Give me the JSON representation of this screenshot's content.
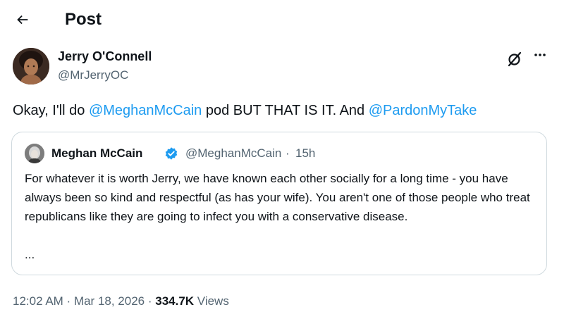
{
  "header": {
    "title": "Post"
  },
  "tweet": {
    "author_name": "Jerry O'Connell",
    "author_handle": "@MrJerryOC",
    "text_part1": "Okay, I'll do ",
    "mention1": "@MeghanMcCain",
    "text_part2": " pod BUT THAT IS IT.  And ",
    "mention2": "@PardonMyTake"
  },
  "quote": {
    "author_name": "Meghan McCain",
    "author_handle": "@MeghanMcCain",
    "separator": "·",
    "time": "15h",
    "text": "For whatever it is worth Jerry, we have known each other socially for a long time - you have always been so kind and respectful (as has your wife). You aren't one of those people who treat republicans like they are going to infect you with a conservative disease.",
    "ellipsis": "..."
  },
  "meta": {
    "time": "12:02 AM",
    "sep1": " · ",
    "date": "Mar 18, 2026",
    "sep2": " · ",
    "views_count": "334.7K",
    "views_label": " Views"
  },
  "icons": {
    "back": "arrow-left-icon",
    "grok": "grok-icon",
    "more": "more-horizontal-icon",
    "verified": "verified-badge-icon"
  },
  "colors": {
    "accent": "#1d9bf0",
    "text": "#0f1419",
    "secondary": "#536471",
    "border": "#cfd9de"
  }
}
